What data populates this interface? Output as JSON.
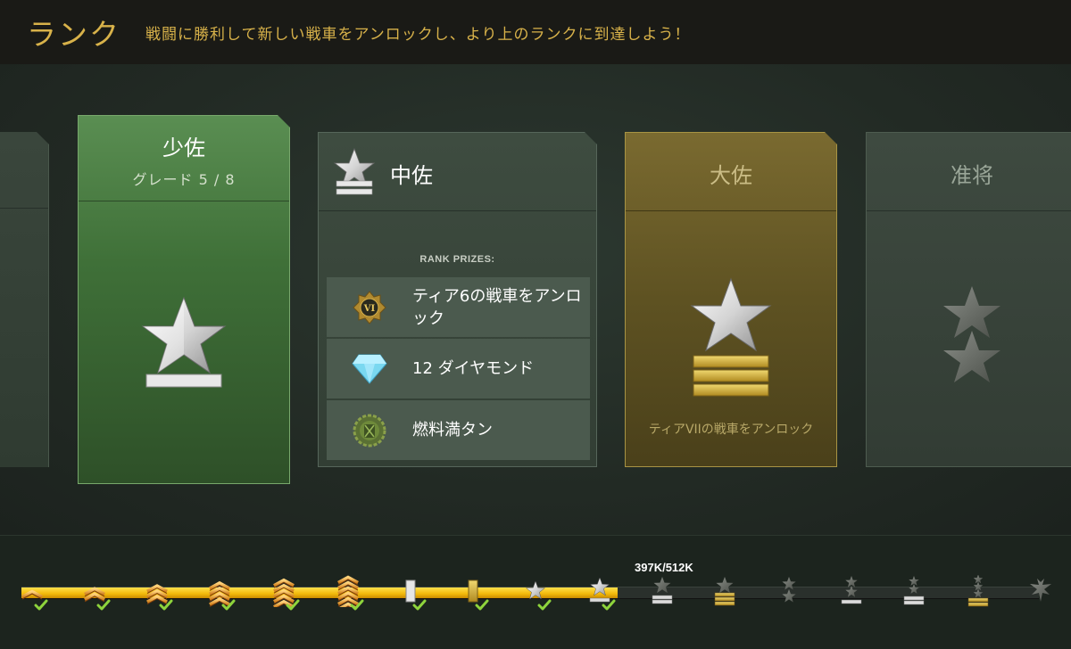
{
  "header": {
    "title": "ランク",
    "subtitle": "戦闘に勝利して新しい戦車をアンロックし、より上のランクに到達しよう！"
  },
  "current_rank": {
    "name": "少佐",
    "grade": "グレード 5 / 8"
  },
  "next_rank": {
    "name": "中佐",
    "prizes_label": "RANK PRIZES:",
    "prizes": [
      {
        "icon": "tier-vi-emblem-icon",
        "text": "ティア6の戦車をアンロック"
      },
      {
        "icon": "diamond-icon",
        "text": "12 ダイヤモンド"
      },
      {
        "icon": "fuel-can-icon",
        "text": "燃料満タン"
      }
    ]
  },
  "future_rank": {
    "name": "大佐",
    "unlock_text": "ティアVIIの戦車をアンロック"
  },
  "far_rank": {
    "name": "准将"
  },
  "progress": {
    "xp_label": "397K/512K",
    "fill_fraction": 0.586,
    "nodes": [
      {
        "icon": "chevron-1-icon",
        "done": true
      },
      {
        "icon": "chevron-2-icon",
        "done": true
      },
      {
        "icon": "chevron-3-icon",
        "done": true
      },
      {
        "icon": "chevron-4-icon",
        "done": true
      },
      {
        "icon": "chevron-5-icon",
        "done": true
      },
      {
        "icon": "chevron-6-icon",
        "done": true
      },
      {
        "icon": "silver-bar-icon",
        "done": true
      },
      {
        "icon": "gold-bar-icon",
        "done": true
      },
      {
        "icon": "star-icon",
        "done": true
      },
      {
        "icon": "star-bar-icon",
        "done": true
      },
      {
        "icon": "star-two-bars-icon",
        "done": false
      },
      {
        "icon": "star-gold-bars-icon",
        "done": false
      },
      {
        "icon": "two-stars-icon",
        "done": false
      },
      {
        "icon": "two-stars-bar-icon",
        "done": false
      },
      {
        "icon": "three-stars-bars-icon",
        "done": false
      },
      {
        "icon": "three-stars-gold-icon",
        "done": false
      },
      {
        "icon": "eagle-icon",
        "done": false
      }
    ]
  },
  "colors": {
    "accent_gold": "#d8b24a",
    "current_green": "#4a7e42",
    "progress_yellow": "#f2c418",
    "check_green": "#8ed43c"
  }
}
